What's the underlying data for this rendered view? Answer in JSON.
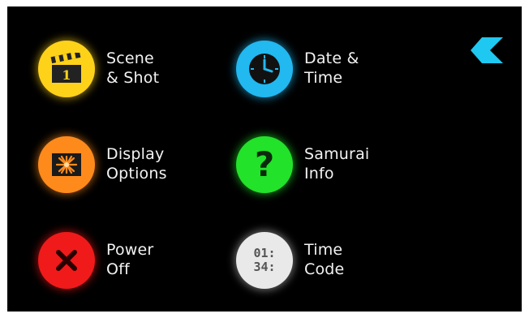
{
  "menu": {
    "scene_shot": {
      "line1": "Scene",
      "line2": "& Shot",
      "icon": "clapperboard-icon",
      "clapper_number": "1",
      "color": "#ffd21a"
    },
    "date_time": {
      "line1": "Date &",
      "line2": "Time",
      "icon": "clock-icon",
      "color": "#22b8f0"
    },
    "display_options": {
      "line1": "Display",
      "line2": "Options",
      "icon": "display-burst-icon",
      "color": "#ff8a1c"
    },
    "samurai_info": {
      "line1": "Samurai",
      "line2": "Info",
      "icon": "question-mark-icon",
      "glyph": "?",
      "color": "#22e22a"
    },
    "power_off": {
      "line1": "Power",
      "line2": "Off",
      "icon": "close-x-icon",
      "color": "#f01a1a"
    },
    "time_code": {
      "line1": "Time",
      "line2": "Code",
      "icon": "timecode-icon",
      "tc_line1": "01:",
      "tc_line2": "34:",
      "color": "#e9e9e9"
    }
  },
  "back_button": {
    "icon": "back-arrow-icon",
    "color": "#1ec8f0"
  }
}
